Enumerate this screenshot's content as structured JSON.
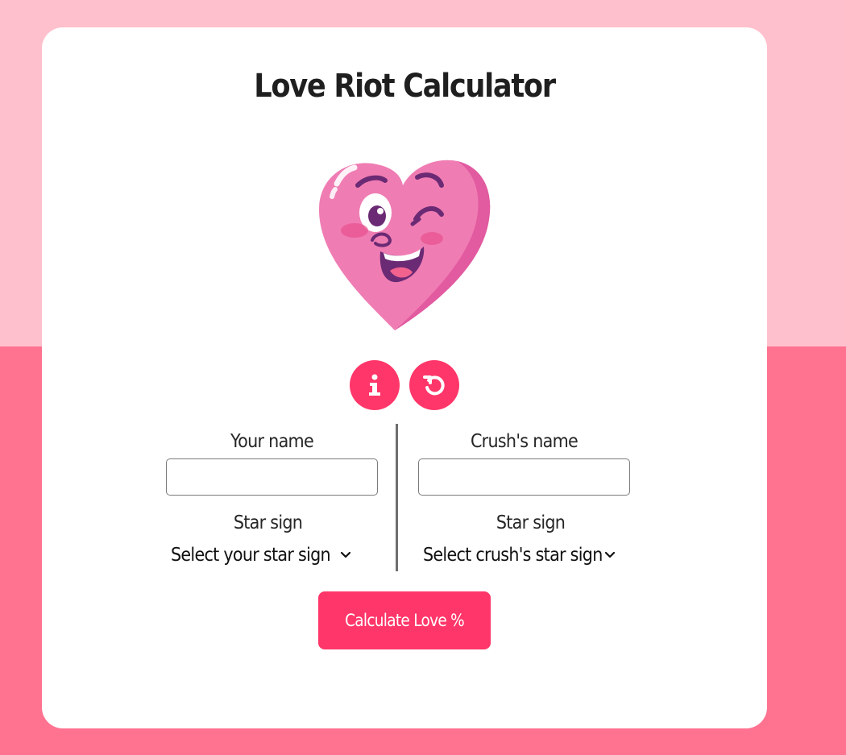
{
  "app": {
    "title": "Love Riot Calculator"
  },
  "icons": {
    "mascot": "winking-heart-mascot",
    "info_button": "info-icon",
    "reset_button": "reset-icon"
  },
  "form": {
    "left": {
      "name_label": "Your name",
      "name_value": "",
      "star_label": "Star sign",
      "star_select_value": "Select your star sign"
    },
    "right": {
      "name_label": "Crush's name",
      "name_value": "",
      "star_label": "Star sign",
      "star_select_value": "Select crush's star sign"
    }
  },
  "actions": {
    "calculate_label": "Calculate Love %"
  },
  "colors": {
    "page_top": "#ffc0cd",
    "page_bottom": "#ff7290",
    "accent": "#ff3669",
    "card": "#ffffff"
  }
}
